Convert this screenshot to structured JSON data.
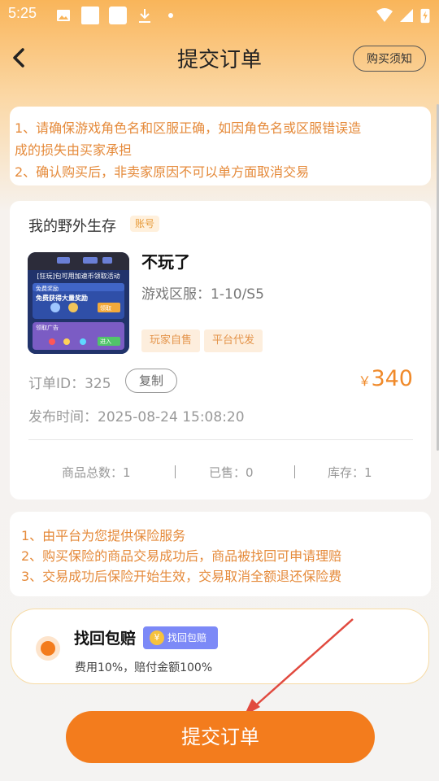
{
  "status_bar": {
    "time": "5:25"
  },
  "header": {
    "title": "提交订单",
    "notice_button": "购买须知"
  },
  "warning_top": {
    "lines": [
      "1、请确保游戏角色名和区服正确，如因角色名或区服错误造",
      "成的损失由买家承担",
      "2、确认购买后，非卖家原因不可以单方面取消交易"
    ]
  },
  "product": {
    "game_name": "我的野外生存",
    "type_tag": "账号",
    "thumbnail_caption": "[狂玩]包可用加速币领取活动",
    "thumbnail_texts": [
      "免费奖励",
      "免费获得大量奖励",
      "领取广告",
      "领取",
      "进入"
    ],
    "title": "不玩了",
    "region_label": "游戏区服：",
    "region_value": "1-10/S5",
    "tags": [
      "玩家自售",
      "平台代发"
    ],
    "order_id_label": "订单ID：",
    "order_id": "325",
    "copy_button": "复制",
    "currency": "￥",
    "price": "340",
    "publish_label": "发布时间：",
    "publish_time": "2025-08-24 15:08:20",
    "stats": [
      {
        "label": "商品总数：",
        "value": "1"
      },
      {
        "label": "已售：",
        "value": "0"
      },
      {
        "label": "库存：",
        "value": "1"
      }
    ]
  },
  "warning_bottom": {
    "lines": [
      "1、由平台为您提供保险服务",
      "2、购买保险的商品交易成功后，商品被找回可申请理赔",
      "3、交易成功后保险开始生效，交易取消全额退还保险费"
    ]
  },
  "insurance": {
    "title": "找回包赔",
    "badge": "找回包赔",
    "badge_icon": "yen-coin-icon",
    "coin_glyph": "¥",
    "description": "费用10%，赔付金额100%",
    "selected": true
  },
  "submit_button": "提交订单",
  "colors": {
    "accent": "#f37c1d",
    "warning_text": "#e58a3a",
    "badge": "#7c89f7",
    "price": "#f08a2a"
  }
}
